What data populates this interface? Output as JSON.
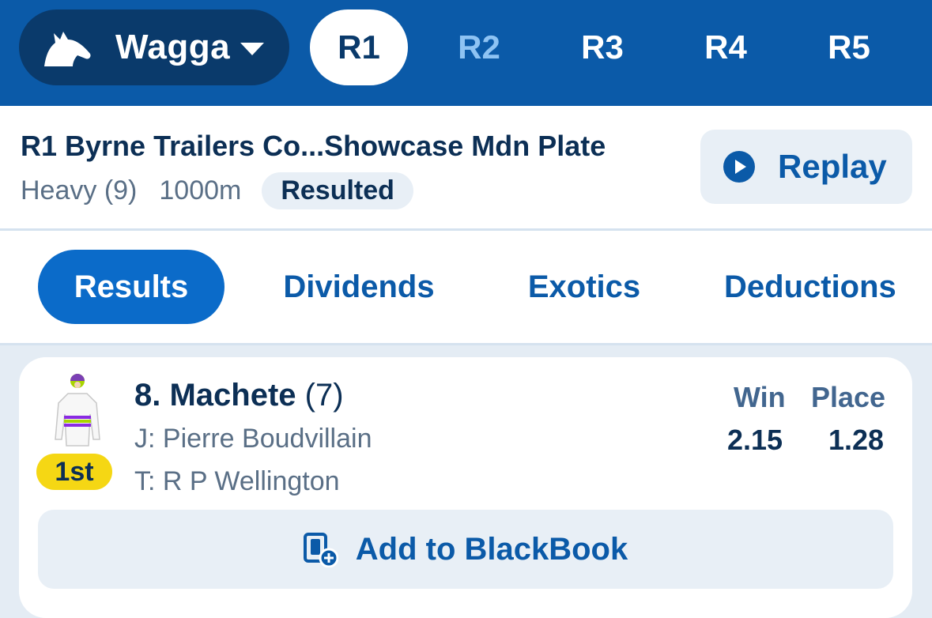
{
  "header": {
    "venue": "Wagga",
    "races": [
      {
        "label": "R1",
        "state": "active"
      },
      {
        "label": "R2",
        "state": "dim"
      },
      {
        "label": "R3",
        "state": "normal"
      },
      {
        "label": "R4",
        "state": "normal"
      },
      {
        "label": "R5",
        "state": "normal"
      }
    ]
  },
  "race": {
    "title": "R1 Byrne Trailers Co...Showcase Mdn Plate",
    "track": "Heavy (9)",
    "distance": "1000m",
    "status": "Resulted",
    "replay_label": "Replay"
  },
  "tabs": [
    {
      "label": "Results",
      "active": true
    },
    {
      "label": "Dividends",
      "active": false
    },
    {
      "label": "Exotics",
      "active": false
    },
    {
      "label": "Deductions",
      "active": false
    }
  ],
  "result": {
    "place": "1st",
    "runner": "8. Machete",
    "barrier": "(7)",
    "jockey": "J: Pierre Boudvillain",
    "trainer": "T: R P Wellington",
    "win_label": "Win",
    "place_label": "Place",
    "win": "2.15",
    "place_odds": "1.28",
    "blackbook_label": "Add to BlackBook"
  },
  "colors": {
    "header_bg": "#0b5aa8",
    "venue_bg": "#0a3a6b",
    "active_tab": "#0b6bc9",
    "place_badge": "#f5d714"
  }
}
